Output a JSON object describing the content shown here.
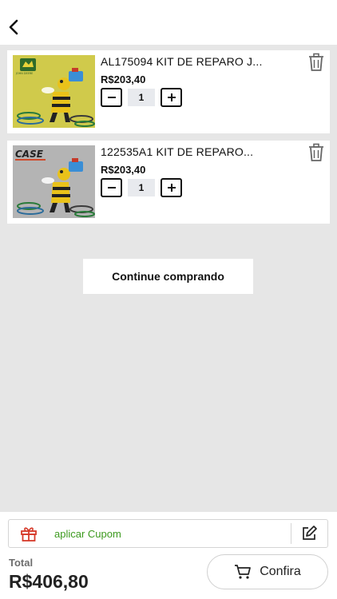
{
  "header": {
    "back_icon": "chevron-left-icon"
  },
  "cart": {
    "items": [
      {
        "name": "AL175094 KIT DE REPARO J...",
        "price": "R$203,40",
        "quantity": "1",
        "brand_logo_text": "JOHN DEERE",
        "thumb_bg": "#c8c13a"
      },
      {
        "name": "122535A1 KIT DE REPARO...",
        "price": "R$203,40",
        "quantity": "1",
        "brand_logo_text": "CASE",
        "thumb_bg": "#9a9a9a"
      }
    ],
    "continue_label": "Continue comprando"
  },
  "footer": {
    "coupon_label": "aplicar Cupom",
    "total_label": "Total",
    "total_value": "R$406,80",
    "confirm_label": "Confira"
  },
  "colors": {
    "coupon_text": "#3c9a1e",
    "gift_icon": "#d63a2a",
    "background": "#e6e6e6"
  }
}
